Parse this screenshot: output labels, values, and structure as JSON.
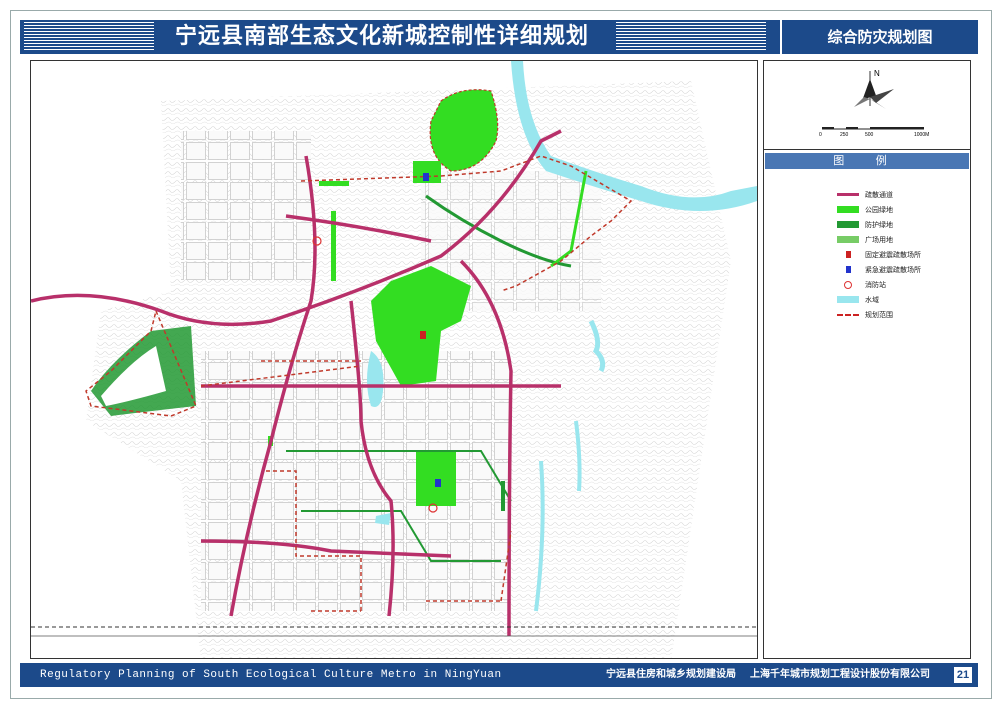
{
  "header": {
    "title": "宁远县南部生态文化新城控制性详细规划",
    "subtitle": "综合防灾规划图"
  },
  "compass": {
    "north_label": "N"
  },
  "scale_bar": {
    "labels": [
      "0",
      "250",
      "500",
      "1000M"
    ]
  },
  "legend": {
    "title": "图 例",
    "items": [
      {
        "label": "疏散通道",
        "symbol": "evacuation-road-icon",
        "color": "#b8306a"
      },
      {
        "label": "公园绿地",
        "symbol": "park-green-icon",
        "color": "#33dd22"
      },
      {
        "label": "防护绿地",
        "symbol": "protective-green-icon",
        "color": "#229933"
      },
      {
        "label": "广场用地",
        "symbol": "plaza-icon",
        "color": "#77cc66"
      },
      {
        "label": "固定避震疏散场所",
        "symbol": "fixed-shelter-icon",
        "color": "#cc2222"
      },
      {
        "label": "紧急避震疏散场所",
        "symbol": "emergency-shelter-icon",
        "color": "#2233cc"
      },
      {
        "label": "消防站",
        "symbol": "fire-station-icon",
        "color": "#dd3333"
      },
      {
        "label": "水域",
        "symbol": "water-icon",
        "color": "#99e6ee"
      },
      {
        "label": "规划范围",
        "symbol": "planning-boundary-icon",
        "color": "#cc2222"
      }
    ]
  },
  "footer": {
    "english_title": "Regulatory Planning of South Ecological Culture Metro in NingYuan",
    "org1": "宁远县住房和城乡规划建设局",
    "org2": "上海千年城市规划工程设计股份有限公司",
    "page": "21"
  }
}
